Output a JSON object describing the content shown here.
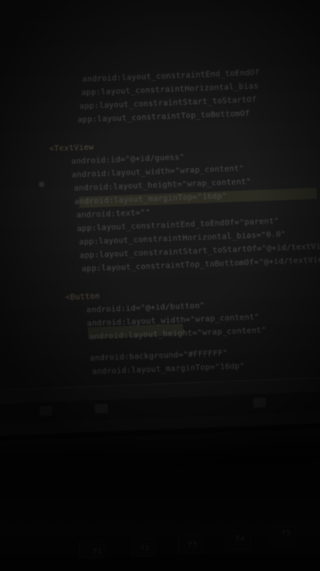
{
  "code_lines": [
    "android:layout_constraintEnd_toEndOf",
    "app:layout_constraintHorizontal_bias",
    "app:layout_constraintStart_toStartOf",
    "app:layout_constraintTop_toBottomOf",
    "<TextView",
    "android:id=\"@+id/guess\"",
    "android:layout_width=\"wrap_content\"",
    "android:layout_height=\"wrap_content\"",
    "android:layout_marginTop=\"16dp\"",
    "android:text=\"\"",
    "app:layout_constraintEnd_toEndOf=\"parent\"",
    "app:layout_constraintHorizontal_bias=\"0.0\"",
    "app:layout_constraintStart_toStartOf=\"@+id/textView\"",
    "app:layout_constraintTop_toBottomOf=\"@+id/textView\" />",
    "<Button",
    "android:id=\"@+id/button\"",
    "android:layout_width=\"wrap_content\"",
    "android:layout_height=\"wrap_content\"",
    "android:background=\"#FFFFFF\"",
    "android:layout_marginTop=\"16dp\""
  ],
  "keyboard_keys": [
    "F1",
    "F2",
    "F3",
    "F4",
    "F5"
  ]
}
